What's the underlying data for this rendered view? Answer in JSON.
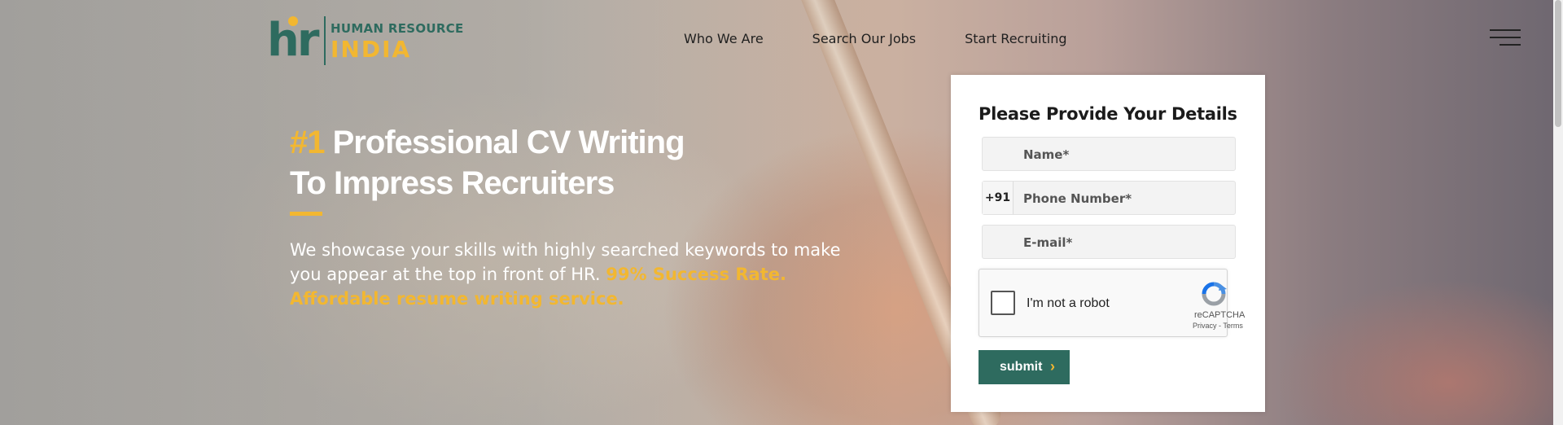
{
  "logo": {
    "mark": "hr",
    "line1": "HUMAN RESOURCE",
    "line2": "INDIA"
  },
  "nav": {
    "items": [
      "Who We Are",
      "Search Our Jobs",
      "Start Recruiting"
    ]
  },
  "hero": {
    "accent": "#1",
    "line1_rest": " Professional CV Writing",
    "line2": "To Impress Recruiters",
    "desc_plain": "We showcase your skills with highly searched keywords to make you appear at the top in front of HR. ",
    "desc_highlight": "99% Success Rate. Affordable resume writing service."
  },
  "form": {
    "title": "Please Provide Your Details",
    "name_placeholder": "Name*",
    "phone_prefix": "+91",
    "phone_placeholder": "Phone Number*",
    "email_placeholder": "E-mail*",
    "captcha_label": "I'm not a robot",
    "captcha_brand": "reCAPTCHA",
    "captcha_terms": "Privacy - Terms",
    "submit_label": "submit"
  },
  "colors": {
    "brand_green": "#2e6b5f",
    "brand_yellow": "#f2b731"
  }
}
